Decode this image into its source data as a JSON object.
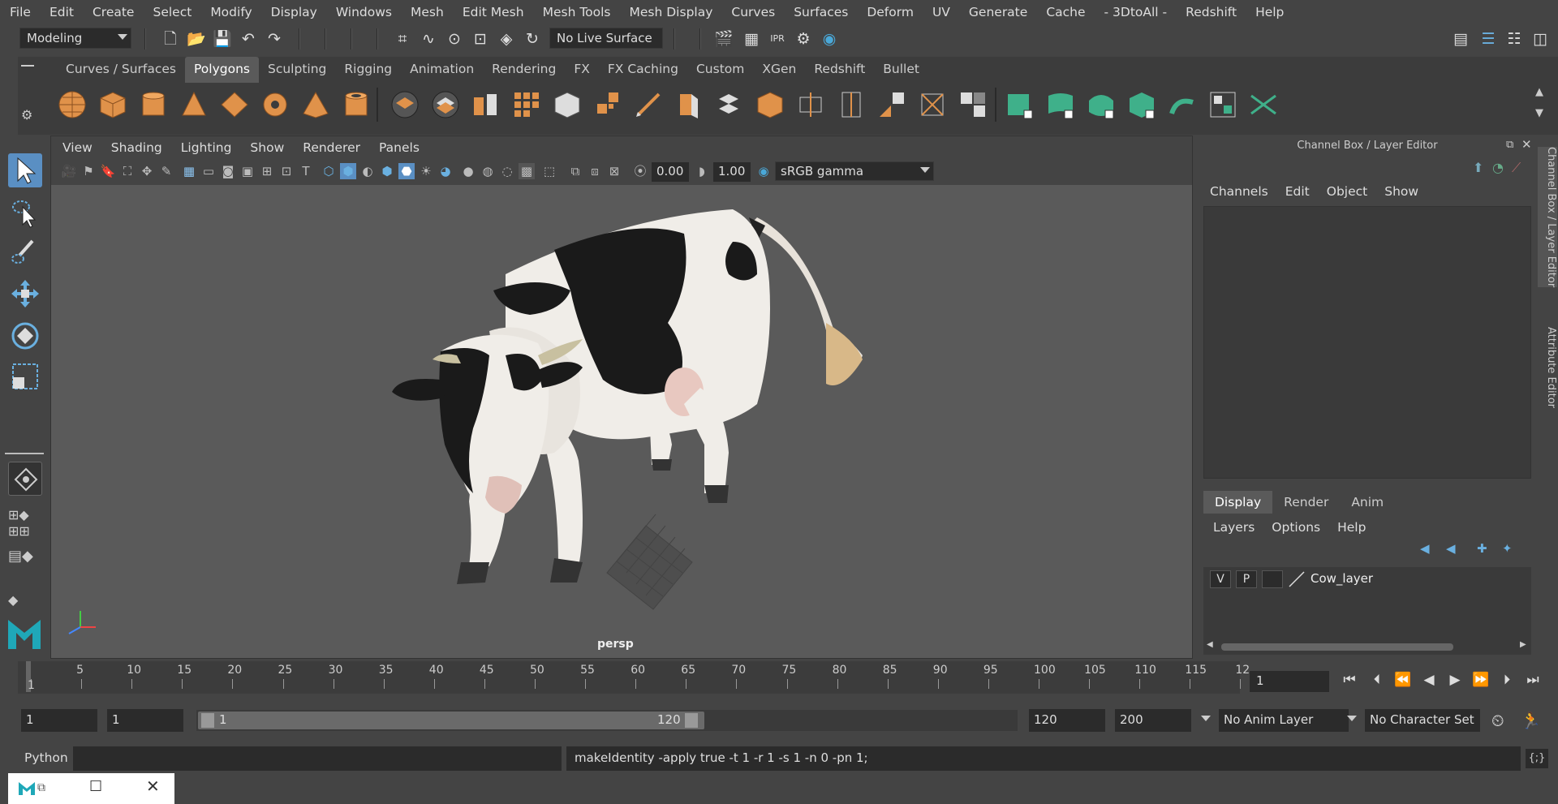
{
  "menu": [
    "File",
    "Edit",
    "Create",
    "Select",
    "Modify",
    "Display",
    "Windows",
    "Mesh",
    "Edit Mesh",
    "Mesh Tools",
    "Mesh Display",
    "Curves",
    "Surfaces",
    "Deform",
    "UV",
    "Generate",
    "Cache",
    "- 3DtoAll -",
    "Redshift",
    "Help"
  ],
  "status": {
    "mode": "Modeling",
    "live_surface": "No Live Surface"
  },
  "shelf_tabs": [
    "Curves / Surfaces",
    "Polygons",
    "Sculpting",
    "Rigging",
    "Animation",
    "Rendering",
    "FX",
    "FX Caching",
    "Custom",
    "XGen",
    "Redshift",
    "Bullet"
  ],
  "shelf_active": "Polygons",
  "viewport": {
    "menu": [
      "View",
      "Shading",
      "Lighting",
      "Show",
      "Renderer",
      "Panels"
    ],
    "exposure": "0.00",
    "gamma": "1.00",
    "color_space": "sRGB gamma",
    "camera": "persp"
  },
  "channel_box": {
    "title": "Channel Box / Layer Editor",
    "menu": [
      "Channels",
      "Edit",
      "Object",
      "Show"
    ],
    "layer_tabs": [
      "Display",
      "Render",
      "Anim"
    ],
    "layer_menu": [
      "Layers",
      "Options",
      "Help"
    ],
    "layer": {
      "v": "V",
      "p": "P",
      "name": "Cow_layer"
    },
    "side_tabs": [
      "Channel Box / Layer Editor",
      "Attribute Editor"
    ]
  },
  "timeline": {
    "labels": [
      "1",
      "5",
      "10",
      "15",
      "20",
      "25",
      "30",
      "35",
      "40",
      "45",
      "50",
      "55",
      "60",
      "65",
      "70",
      "75",
      "80",
      "85",
      "90",
      "95",
      "100",
      "105",
      "110",
      "115",
      "12"
    ],
    "current_frame": "1"
  },
  "range": {
    "start": "1",
    "playback_start": "1",
    "slider_start": "1",
    "slider_end": "120",
    "playback_end": "120",
    "end": "200",
    "anim_layer": "No Anim Layer",
    "character_set": "No Character Set"
  },
  "command": {
    "language": "Python",
    "feedback": "makeIdentity -apply true -t 1 -r 1 -s 1 -n 0 -pn 1;"
  },
  "colors": {
    "selected_tool": "#5a8fc3",
    "shelf_icon": "#e0924a",
    "teal_icon": "#3fb08a"
  }
}
